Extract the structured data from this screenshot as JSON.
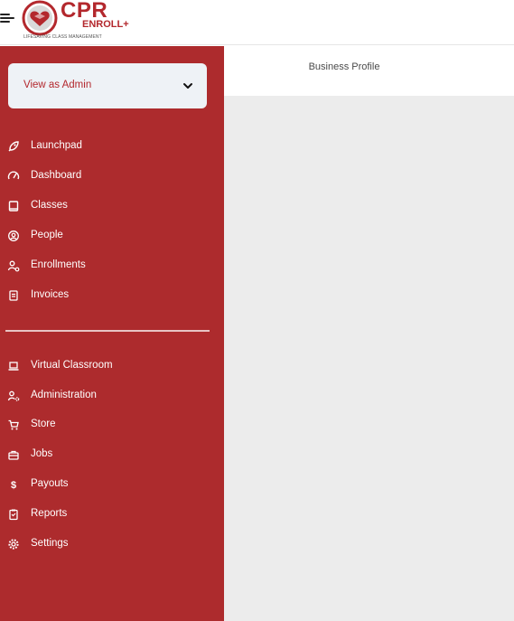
{
  "header": {
    "menu_icon": "hamburger-icon",
    "logo": {
      "brand": "CPR",
      "product": "ENROLL",
      "plus": "+",
      "tagline": "LIFESAVING CLASS MANAGEMENT"
    }
  },
  "role_selector": {
    "value": "View as Admin",
    "icon": "chevron-down-icon"
  },
  "sidebar": {
    "primary_items": [
      {
        "label": "Launchpad",
        "icon": "rocket-icon"
      },
      {
        "label": "Dashboard",
        "icon": "gauge-icon"
      },
      {
        "label": "Classes",
        "icon": "book-icon"
      },
      {
        "label": "People",
        "icon": "user-circle-icon"
      },
      {
        "label": "Enrollments",
        "icon": "user-check-icon"
      },
      {
        "label": "Invoices",
        "icon": "invoice-icon"
      }
    ],
    "secondary_items": [
      {
        "label": "Virtual Classroom",
        "icon": "laptop-icon"
      },
      {
        "label": "Administration",
        "icon": "user-gear-icon"
      },
      {
        "label": "Store",
        "icon": "cart-icon"
      },
      {
        "label": "Jobs",
        "icon": "briefcase-icon"
      },
      {
        "label": "Payouts",
        "icon": "dollar-icon"
      },
      {
        "label": "Reports",
        "icon": "clipboard-icon"
      },
      {
        "label": "Settings",
        "icon": "gear-icon"
      }
    ]
  },
  "main": {
    "page_title": "Business Profile"
  },
  "colors": {
    "brand_red": "#ad2b2d",
    "logo_red": "#b3282d",
    "content_bg": "#ececec",
    "selector_bg": "#eef2f6"
  }
}
